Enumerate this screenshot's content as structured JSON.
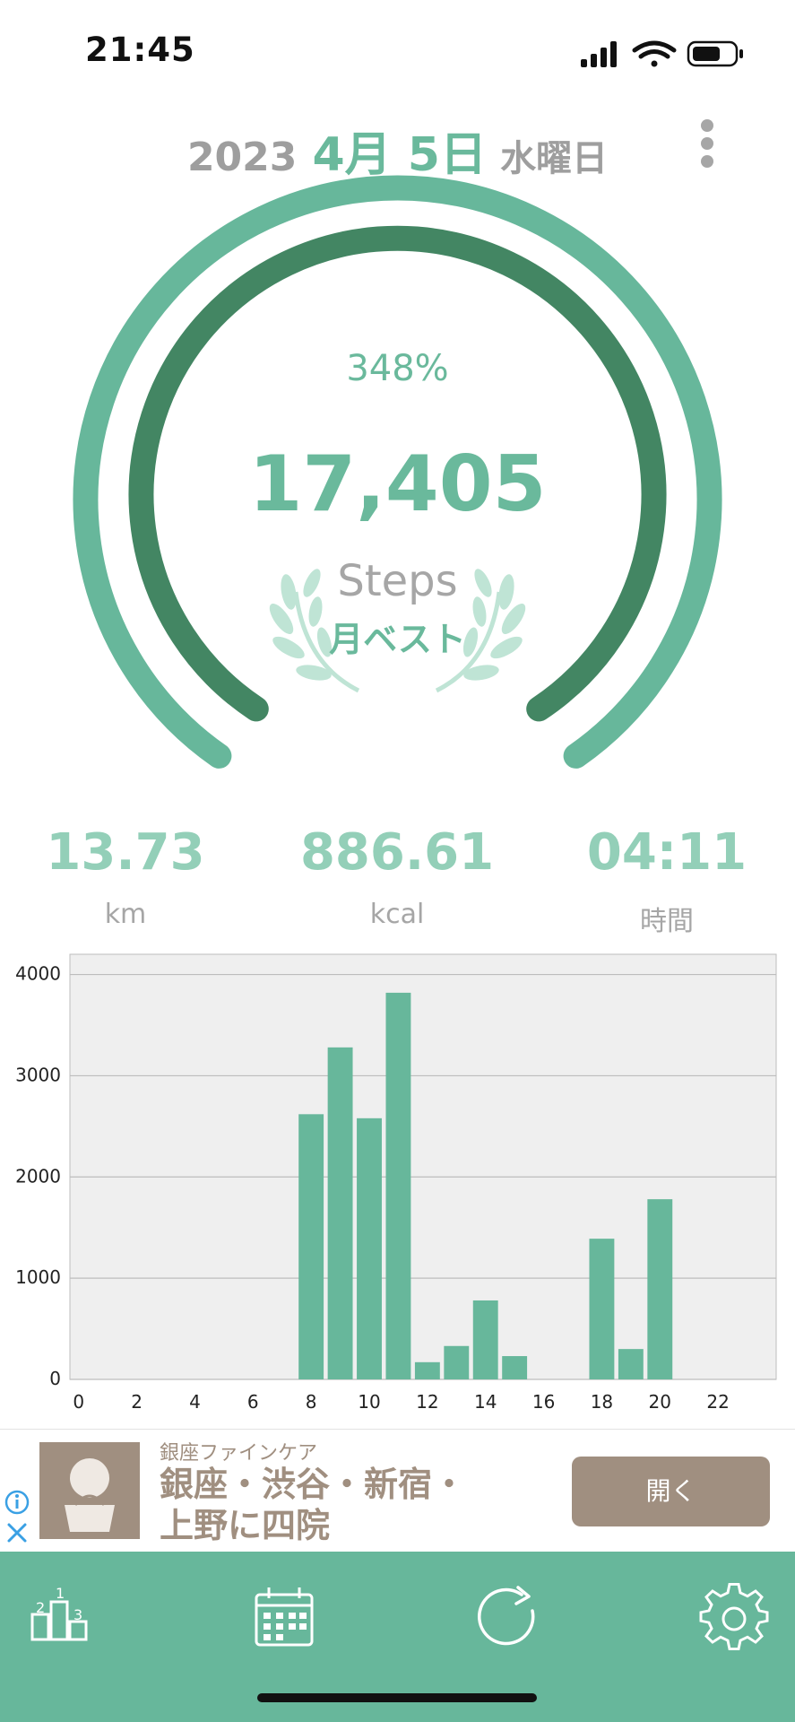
{
  "status_bar": {
    "time": "21:45"
  },
  "date": {
    "year": "2023",
    "month_day": "4月 5日",
    "weekday": "水曜日"
  },
  "progress": {
    "percent_text": "348%",
    "outer_ring_fraction": 1.0,
    "inner_ring_fraction": 1.0
  },
  "steps": {
    "value": "17,405",
    "label": "Steps",
    "award": "月ベスト"
  },
  "stats": [
    {
      "value": "13.73",
      "unit": "km"
    },
    {
      "value": "886.61",
      "unit": "kcal"
    },
    {
      "value": "04:11",
      "unit": "時間"
    }
  ],
  "chart_data": {
    "type": "bar",
    "x": [
      0,
      1,
      2,
      3,
      4,
      5,
      6,
      7,
      8,
      9,
      10,
      11,
      12,
      13,
      14,
      15,
      16,
      17,
      18,
      19,
      20,
      21,
      22,
      23
    ],
    "values": [
      0,
      0,
      0,
      0,
      0,
      0,
      0,
      0,
      2620,
      3280,
      2580,
      3820,
      170,
      330,
      780,
      230,
      0,
      0,
      1390,
      300,
      1780,
      0,
      0,
      0
    ],
    "xticks": [
      "0",
      "2",
      "4",
      "6",
      "8",
      "10",
      "12",
      "14",
      "16",
      "18",
      "20",
      "22"
    ],
    "yticks": [
      "0",
      "1000",
      "2000",
      "3000",
      "4000"
    ],
    "ylim": [
      0,
      4200
    ],
    "grid": true,
    "colors": {
      "bar": "#67b79b",
      "plot_bg": "#efefef"
    }
  },
  "ad": {
    "brand": "銀座ファインケア",
    "title_line1": "銀座・渋谷・新宿・",
    "title_line2": "上野に四院",
    "open_label": "開く"
  },
  "tabs": [
    {
      "icon": "ranking-icon"
    },
    {
      "icon": "calendar-icon"
    },
    {
      "icon": "refresh-icon"
    },
    {
      "icon": "settings-icon"
    }
  ],
  "colors": {
    "accent": "#67b79b",
    "accent_dark": "#438663",
    "light_accent": "#93cfb8",
    "ad": "#a08f80"
  }
}
